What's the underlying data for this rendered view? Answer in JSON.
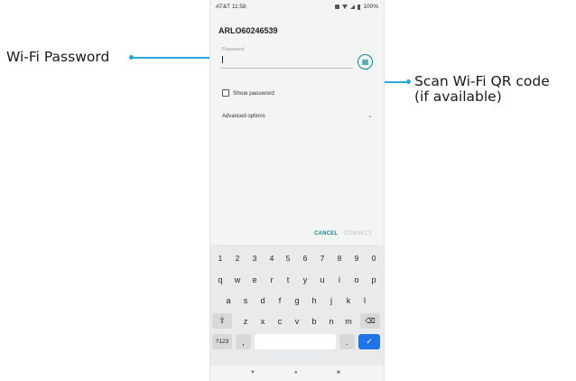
{
  "callouts": {
    "wifi_password": "Wi-Fi Password",
    "scan_qr_line1": "Scan Wi-Fi QR code",
    "scan_qr_line2": "(if available)"
  },
  "status_bar": {
    "carrier_time": "AT&T 11:58",
    "battery": "100%"
  },
  "dialog": {
    "network_name": "ARLO60246539",
    "password_label": "Password",
    "password_value": "",
    "qr_icon": "qr-code-icon",
    "show_password_label": "Show password",
    "show_password_checked": false,
    "advanced_options_label": "Advanced options",
    "cancel_label": "CANCEL",
    "connect_label": "CONNECT"
  },
  "keyboard": {
    "number_row": [
      "1",
      "2",
      "3",
      "4",
      "5",
      "6",
      "7",
      "8",
      "9",
      "0"
    ],
    "row1": [
      "q",
      "w",
      "e",
      "r",
      "t",
      "y",
      "u",
      "i",
      "o",
      "p"
    ],
    "row2": [
      "a",
      "s",
      "d",
      "f",
      "g",
      "h",
      "j",
      "k",
      "l"
    ],
    "row3": [
      "z",
      "x",
      "c",
      "v",
      "b",
      "n",
      "m"
    ],
    "symbols_key": "?123",
    "comma_key": ",",
    "period_key": ".",
    "shift_icon": "shift-icon",
    "backspace_icon": "backspace-icon",
    "enter_icon": "checkmark-icon"
  },
  "nav_bar": {
    "back_icon": "back-triangle-icon",
    "home_icon": "home-circle-icon",
    "recents_icon": "recents-square-icon"
  },
  "colors": {
    "accent": "#0e8b8f",
    "callout": "#2ea8dc",
    "enter_key": "#1f74e8"
  }
}
